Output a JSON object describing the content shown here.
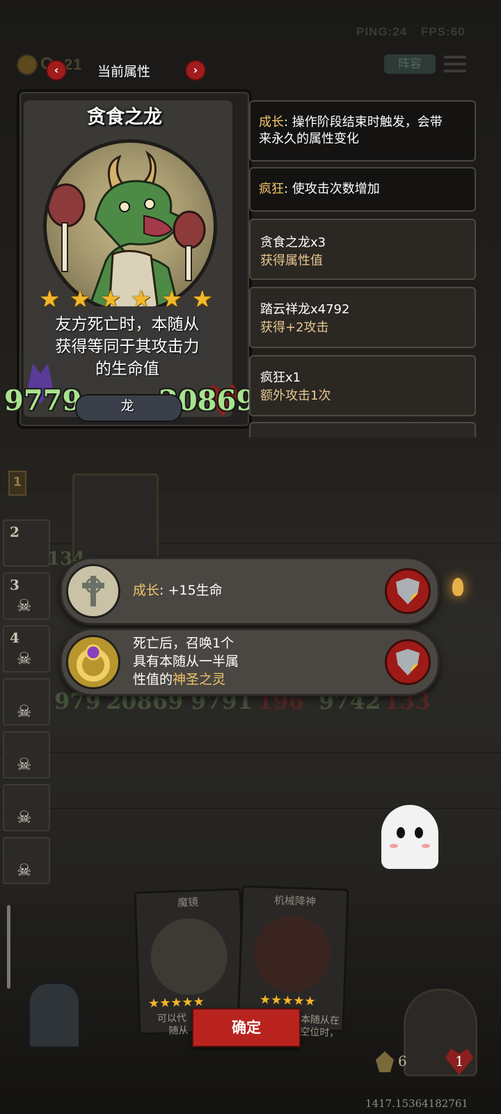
{
  "hud": {
    "ping": "PING:24",
    "fps": "FPS:60",
    "gold_prefix": "O",
    "gold_value": "21",
    "lineup_label": "阵容"
  },
  "header": {
    "title": "当前属性",
    "prev_icon": "chevron-left-icon",
    "next_icon": "chevron-right-icon"
  },
  "card": {
    "name": "贪食之龙",
    "stars": [
      "★",
      "★",
      "★",
      "★",
      "★",
      "★"
    ],
    "star_count": 6,
    "description_lines": [
      "友方死亡时，本随从",
      "获得等同于其攻击力",
      "的生命值"
    ],
    "attack": "9779",
    "health": "20869",
    "tribe": "龙"
  },
  "info_panels": [
    {
      "keyword": "成长",
      "text": ": 操作阶段结束时触发，会带",
      "text2": "来永久的属性变化"
    },
    {
      "keyword": "疯狂",
      "text": ": 使攻击次数增加"
    }
  ],
  "buff_list": [
    {
      "title": "贪食之龙x3",
      "detail": "获得属性值"
    },
    {
      "title": "踏云祥龙x4792",
      "detail": "获得+2攻击"
    },
    {
      "title": "疯狂x1",
      "detail": "额外攻击1次"
    }
  ],
  "side_slots": [
    {
      "num": "1"
    },
    {
      "num": "2"
    },
    {
      "num": "3"
    },
    {
      "num": "4"
    }
  ],
  "effects": [
    {
      "keyword": "成长",
      "colon": ": ",
      "text": "+15生命",
      "icon": "gravestone-cross-icon"
    },
    {
      "line1": "死亡后，召唤1个",
      "line2": "具有本随从一半属",
      "line3_prefix": "性值的",
      "line3_kw": "神圣之灵",
      "icon": "gold-ring-icon"
    }
  ],
  "board_stats": [
    "979",
    "20869",
    "9791",
    "196",
    "9742",
    "133",
    "134"
  ],
  "hand": [
    {
      "title": "魔镜",
      "text_left": "可以代",
      "text_left2": "随从"
    },
    {
      "title": "机械降神",
      "text_right": "本随从在",
      "text_right2": "空位时，"
    }
  ],
  "confirm_label": "确定",
  "bottom": {
    "coin_count": "6",
    "heart_count": "1",
    "coords_text": "1417.15364182761"
  },
  "colors": {
    "stat_green": "#a8e38e",
    "keyword_gold": "#f0c46b",
    "confirm_red": "#b9231e",
    "star_gold": "#f2b72a"
  }
}
